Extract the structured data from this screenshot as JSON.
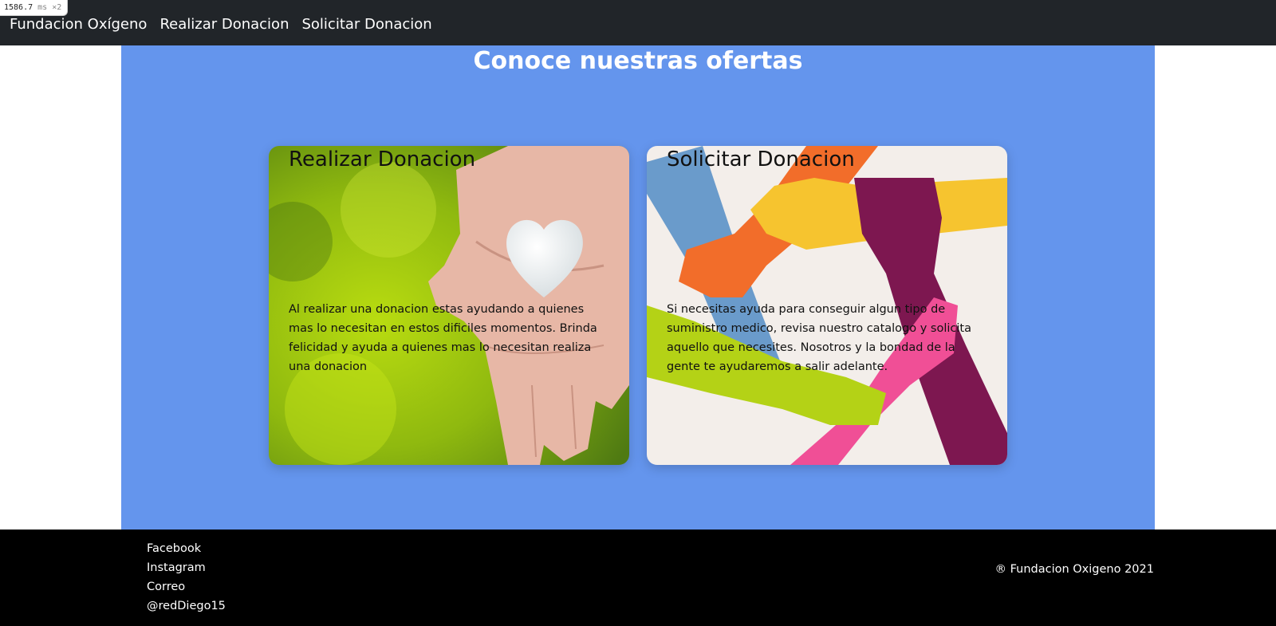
{
  "perf": {
    "value": "1586.7",
    "unit": "ms ×2"
  },
  "nav": {
    "brand": "Fundacion Oxígeno",
    "items": [
      "Realizar Donacion",
      "Solicitar Donacion"
    ]
  },
  "main": {
    "title": "Conoce nuestras ofertas",
    "cards": [
      {
        "title": "Realizar Donacion",
        "text": "Al realizar una donacion estas ayudando a quienes mas lo necesitan en estos dificiles momentos. Brinda felicidad y ayuda a quienes mas lo necesitan realiza una donacion"
      },
      {
        "title": "Solicitar Donacion",
        "text": "Si necesitas ayuda para conseguir algun tipo de suministro medico, revisa nuestro catalogo y solicita aquello que necesites. Nosotros y la bondad de la gente te ayudaremos a salir adelante."
      }
    ]
  },
  "footer": {
    "links": [
      "Facebook",
      "Instagram",
      "Correo",
      "@redDiego15"
    ],
    "copyright": "® Fundacion Oxigeno 2021"
  },
  "colors": {
    "navbar": "#212529",
    "main_bg": "#6495ed",
    "footer": "#000000"
  },
  "images": {
    "card_1": "hand-holding-white-heart-stone-photo",
    "card_2": "colorful-hands-holding-wrists-circle-illustration"
  }
}
